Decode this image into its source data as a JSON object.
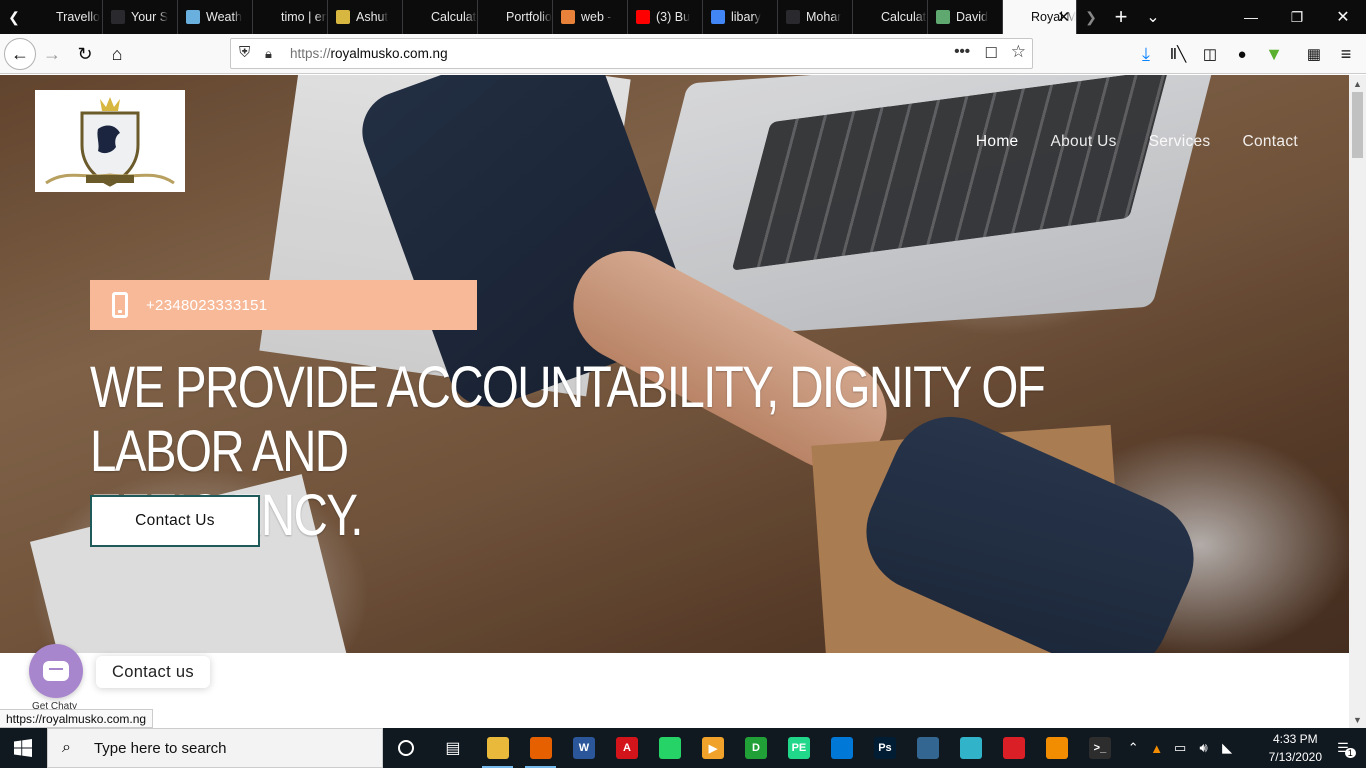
{
  "browser": {
    "tabs": [
      {
        "title": "Travello",
        "color": "#0c0c0d"
      },
      {
        "title": "Your S",
        "color": "#2a2a2e"
      },
      {
        "title": "Weath",
        "color": "#6ab0de"
      },
      {
        "title": "timo | eng",
        "color": "#0c0c0d"
      },
      {
        "title": "Ashut",
        "color": "#d7b740"
      },
      {
        "title": "Calculator",
        "color": "#0c0c0d"
      },
      {
        "title": "Portfolio",
        "color": "#0c0c0d"
      },
      {
        "title": "web -",
        "color": "#e8823a"
      },
      {
        "title": "(3) Bu",
        "color": "#ff0000"
      },
      {
        "title": "libary",
        "color": "#4285f4"
      },
      {
        "title": "Mohar",
        "color": "#2a2a2e"
      },
      {
        "title": "Calculator",
        "color": "#0c0c0d"
      },
      {
        "title": "David",
        "color": "#5fa86f"
      },
      {
        "title": "Royal M",
        "color": "#f9f9fa"
      }
    ],
    "active_tab_index": 13,
    "url_scheme": "https://",
    "url_host": "royalmusko.com.ng",
    "status_link": "https://royalmusko.com.ng"
  },
  "site": {
    "nav": [
      {
        "label": "Home",
        "active": true
      },
      {
        "label": "About Us",
        "active": false
      },
      {
        "label": "Services",
        "active": false
      },
      {
        "label": "Contact",
        "active": false
      }
    ],
    "phone": "+2348023333151",
    "headline_line1": "WE PROVIDE ACCOUNTABILITY, DIGNITY OF LABOR AND",
    "headline_line2": "EFFICIENCY.",
    "cta_label": "Contact Us",
    "accent_color": "#f7b998"
  },
  "chaty": {
    "label": "Contact us",
    "sub_label": "Get Chaty"
  },
  "taskbar": {
    "search_placeholder": "Type here to search",
    "time": "4:33 PM",
    "date": "7/13/2020",
    "notification_count": "1",
    "apps": [
      {
        "name": "file-explorer",
        "glyph": "",
        "color": "#e8b93a"
      },
      {
        "name": "firefox",
        "glyph": "",
        "color": "#e66000"
      },
      {
        "name": "word",
        "glyph": "W",
        "color": "#2b579a"
      },
      {
        "name": "acrobat",
        "glyph": "A",
        "color": "#d4141b"
      },
      {
        "name": "whatsapp",
        "glyph": "",
        "color": "#25d366"
      },
      {
        "name": "media-player",
        "glyph": "▶",
        "color": "#f1a22a"
      },
      {
        "name": "green-app",
        "glyph": "D",
        "color": "#21a038"
      },
      {
        "name": "pycharm",
        "glyph": "PE",
        "color": "#21d789"
      },
      {
        "name": "vscode",
        "glyph": "",
        "color": "#0078d7"
      },
      {
        "name": "photoshop",
        "glyph": "Ps",
        "color": "#001d34"
      },
      {
        "name": "postgres",
        "glyph": "",
        "color": "#336791"
      },
      {
        "name": "teal-app",
        "glyph": "",
        "color": "#31b3c9"
      },
      {
        "name": "creative-cloud",
        "glyph": "",
        "color": "#da1f26"
      },
      {
        "name": "vlc",
        "glyph": "",
        "color": "#f28c00"
      },
      {
        "name": "terminal",
        "glyph": ">_",
        "color": "#2d2d2d"
      }
    ]
  }
}
